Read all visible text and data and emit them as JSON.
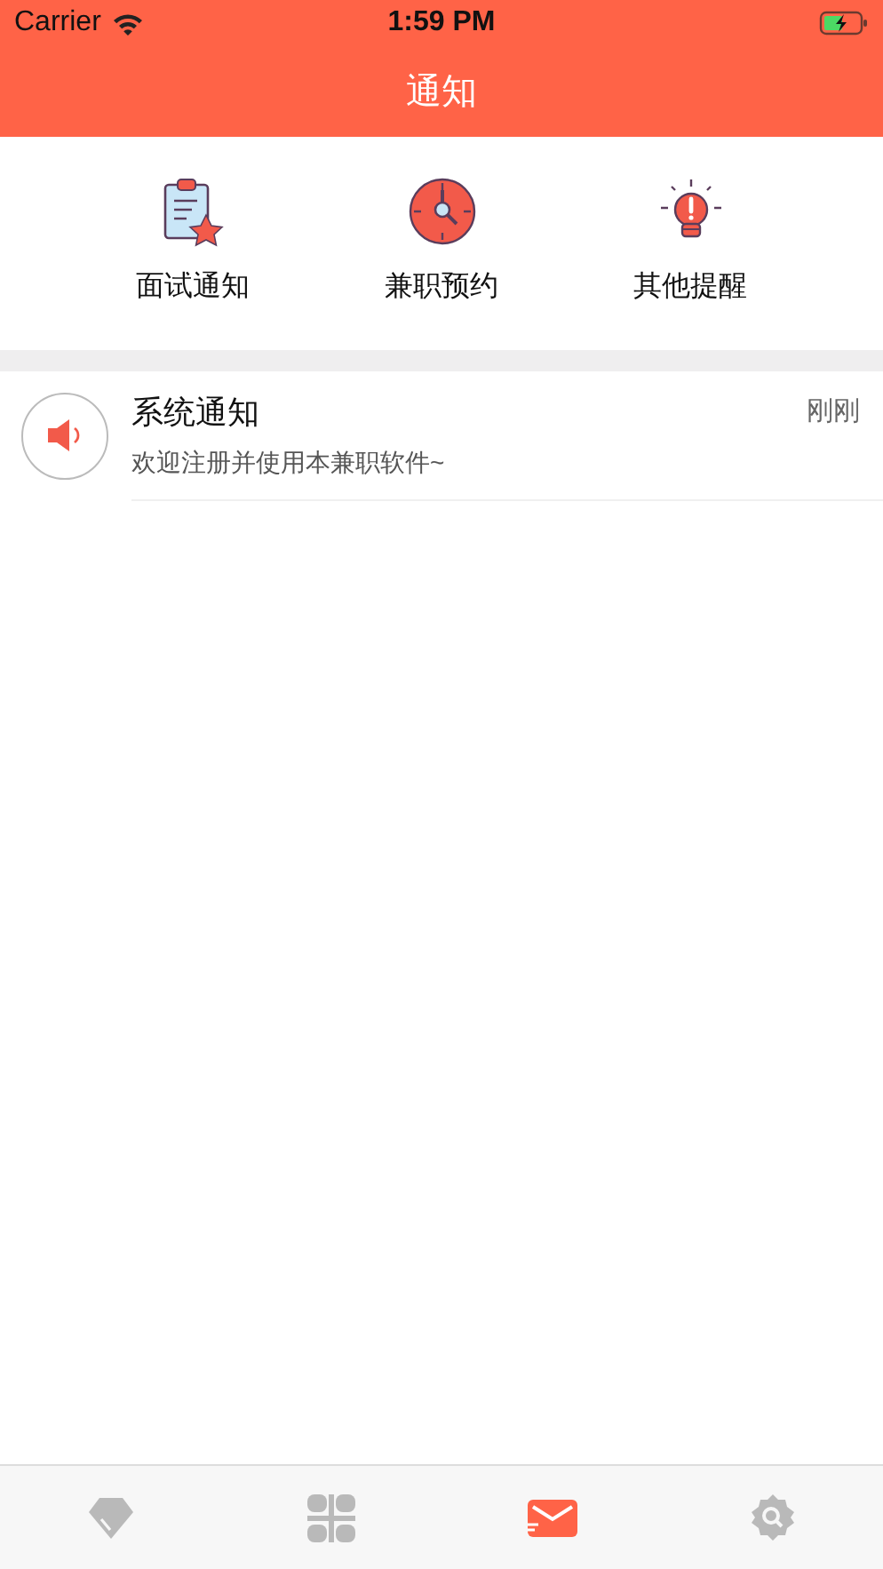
{
  "status_bar": {
    "carrier": "Carrier",
    "time": "1:59 PM"
  },
  "nav": {
    "title": "通知"
  },
  "categories": [
    {
      "kind": "interview",
      "label": "面试通知"
    },
    {
      "kind": "appointment",
      "label": "兼职预约"
    },
    {
      "kind": "reminder",
      "label": "其他提醒"
    }
  ],
  "notifications": [
    {
      "title": "系统通知",
      "message": "欢迎注册并使用本兼职软件~",
      "time": "刚刚"
    }
  ],
  "tab_bar": [
    {
      "kind": "diamond",
      "selected": false
    },
    {
      "kind": "grid",
      "selected": false
    },
    {
      "kind": "mail",
      "selected": true
    },
    {
      "kind": "gear",
      "selected": false
    }
  ]
}
